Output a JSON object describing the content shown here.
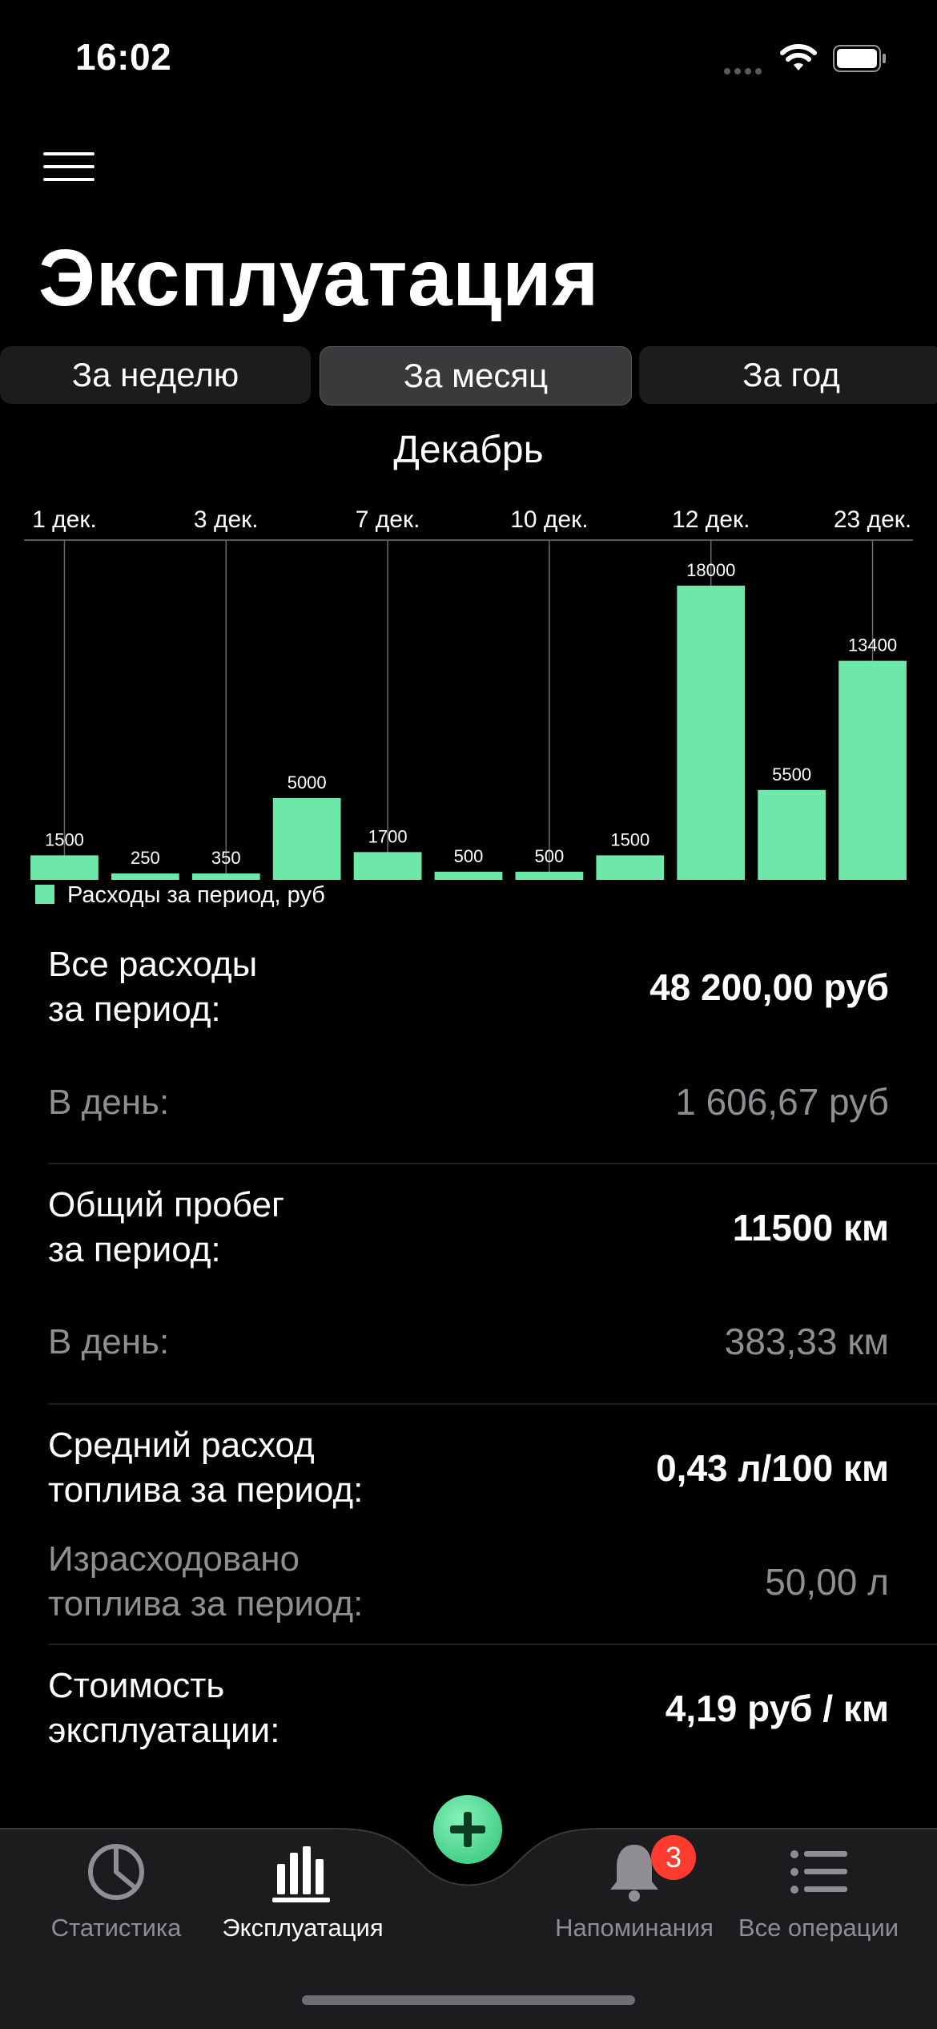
{
  "status_bar": {
    "time": "16:02"
  },
  "header": {
    "title": "Эксплуатация"
  },
  "segments": [
    {
      "label": "За неделю",
      "active": false
    },
    {
      "label": "За месяц",
      "active": true
    },
    {
      "label": "За год",
      "active": false
    }
  ],
  "chart_data": {
    "type": "bar",
    "title": "Декабрь",
    "top_labels": [
      "1 дек.",
      "3 дек.",
      "7 дек.",
      "10 дек.",
      "12 дек.",
      "23 дек."
    ],
    "values": [
      1500,
      250,
      350,
      5000,
      1700,
      500,
      500,
      1500,
      18000,
      5500,
      13400
    ],
    "ylim": [
      0,
      20000
    ],
    "legend": "Расходы за период, руб",
    "legend_placement": "bottom-left",
    "bar_color": "#6ee8a8",
    "grid": false
  },
  "stats": {
    "total_label": "Все расходы\nза период:",
    "total_value": "48 200,00 руб",
    "total_per_day_label": "В день:",
    "total_per_day_value": "1 606,67 руб",
    "mileage_label": "Общий пробег\nза период:",
    "mileage_value": "11500 км",
    "mileage_per_day_label": "В день:",
    "mileage_per_day_value": "383,33 км",
    "fuel_avg_label": "Средний расход\nтоплива за период:",
    "fuel_avg_value": "0,43 л/100 км",
    "fuel_used_label": "Израсходовано\nтоплива за период:",
    "fuel_used_value": "50,00 л",
    "cost_label": "Стоимость\nэксплуатации:",
    "cost_value": "4,19 руб / км"
  },
  "tabbar": {
    "items": [
      {
        "label": "Статистика",
        "icon": "pie-chart-icon",
        "active": false
      },
      {
        "label": "Эксплуатация",
        "icon": "bar-chart-icon",
        "active": true
      },
      {
        "label": "Напоминания",
        "icon": "bell-icon",
        "active": false
      },
      {
        "label": "Все операции",
        "icon": "list-icon",
        "active": false
      }
    ],
    "badge": "3"
  },
  "colors": {
    "accent": "#6ee8a8",
    "badge": "#ff3b30",
    "muted": "#8e8e93"
  }
}
